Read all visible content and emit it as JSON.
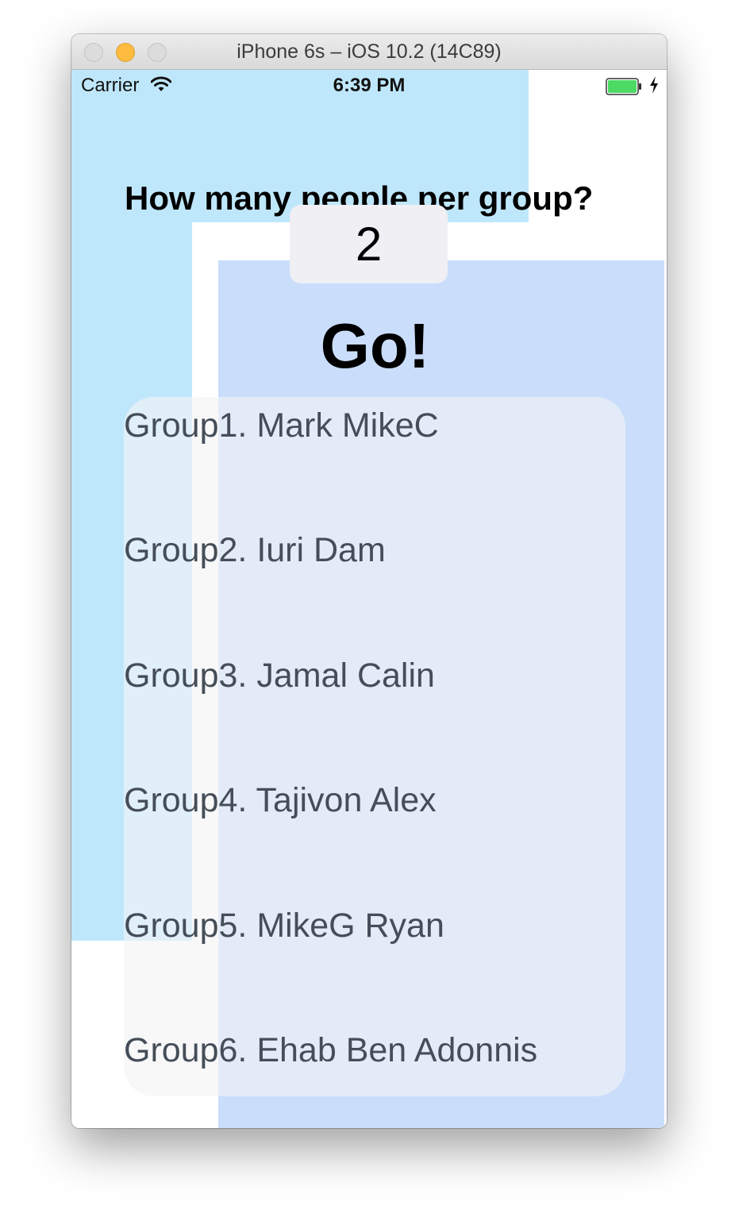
{
  "window": {
    "title": "iPhone 6s – iOS 10.2 (14C89)"
  },
  "status_bar": {
    "carrier": "Carrier",
    "time": "6:39 PM",
    "wifi_icon": "wifi-icon",
    "battery_icon": "battery-icon",
    "charging_icon": "charging-bolt-icon",
    "battery_color": "#4cd964"
  },
  "main": {
    "question": "How many people per group?",
    "people_per_group": "2",
    "go_label": "Go!"
  },
  "groups": [
    "Group1. Mark MikeC",
    "Group2. Iuri Dam",
    "Group3. Jamal Calin",
    "Group4. Tajivon Alex",
    "Group5. MikeG Ryan",
    "Group6. Ehab Ben Adonnis"
  ],
  "colors": {
    "background_light_blue": "#bfe7fb",
    "background_blue": "#cadefb",
    "field_background": "#efeff4",
    "group_text": "#454e58"
  }
}
